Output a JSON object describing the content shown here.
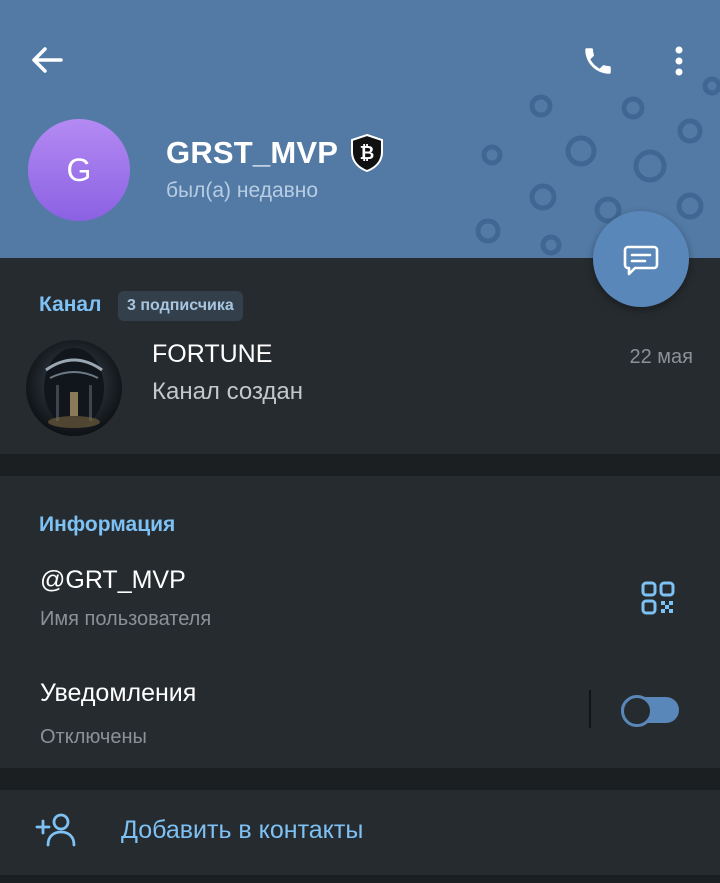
{
  "profile": {
    "avatar_letter": "G",
    "name": "GRST_MVP",
    "status": "был(а) недавно"
  },
  "icons": {
    "back": "arrow-left-icon",
    "call": "phone-icon",
    "menu": "more-vertical-icon",
    "badge": "bitcoin-shield-icon",
    "fab": "message-icon",
    "qr": "qr-code-icon",
    "add_contact": "add-person-icon"
  },
  "channel": {
    "section_label": "Канал",
    "subscribers": "3 подписчика",
    "name": "FORTUNE",
    "last_message": "Канал создан",
    "date": "22 мая"
  },
  "info": {
    "section_label": "Информация",
    "username": "@GRT_MVP",
    "username_caption": "Имя пользователя",
    "notifications_label": "Уведомления",
    "notifications_state": "Отключены"
  },
  "actions": {
    "add_contact": "Добавить в контакты"
  },
  "colors": {
    "header": "#527aa5",
    "accent": "#7ec1f4",
    "card": "#262b2f",
    "background": "#1b1f22",
    "fab": "#5a87b9"
  }
}
